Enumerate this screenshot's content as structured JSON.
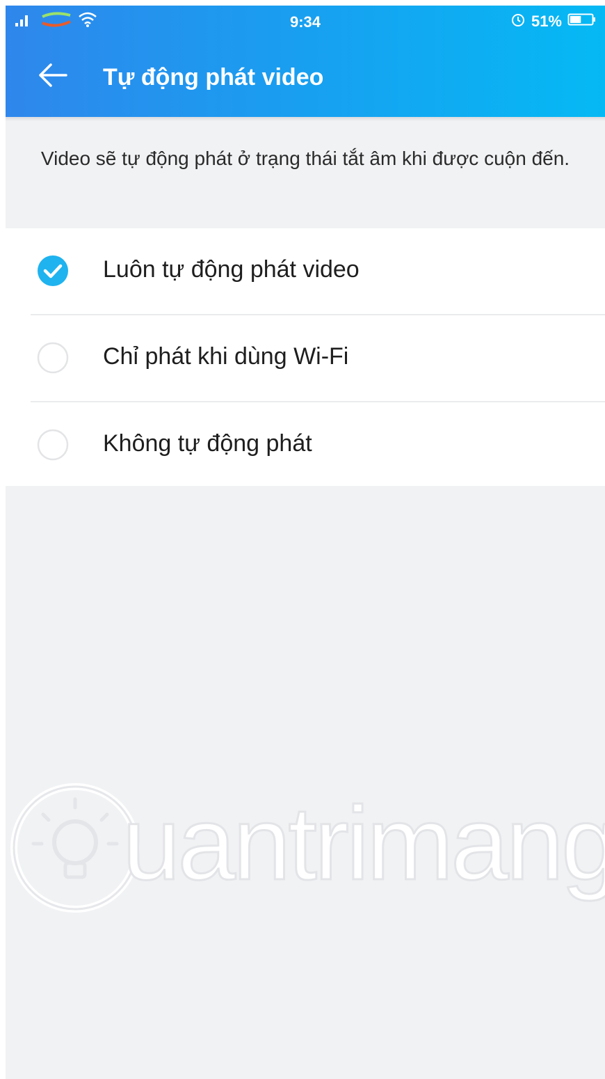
{
  "status_bar": {
    "signal_icon": "signal-bars-icon",
    "carrier_icon": "carrier-logo-icon",
    "wifi_icon": "wifi-icon",
    "time": "9:34",
    "alarm_icon": "alarm-icon",
    "battery_percent": "51%",
    "battery_icon": "battery-icon",
    "battery_level": 0.51
  },
  "app_bar": {
    "back_icon": "back-arrow-icon",
    "title": "Tự động phát video",
    "gradient_colors": [
      "#2f87ec",
      "#05b9f4"
    ]
  },
  "description": "Video sẽ tự động phát ở trạng thái tắt âm khi được cuộn đến.",
  "options": [
    {
      "label": "Luôn tự động phát video",
      "selected": true
    },
    {
      "label": "Chỉ phát khi dùng Wi-Fi",
      "selected": false
    },
    {
      "label": "Không tự động phát",
      "selected": false
    }
  ],
  "colors": {
    "accent": "#1fb3ef",
    "background": "#f1f2f4",
    "list_background": "#ffffff",
    "text": "#1e1e1e"
  },
  "watermark": "Quantrimang"
}
